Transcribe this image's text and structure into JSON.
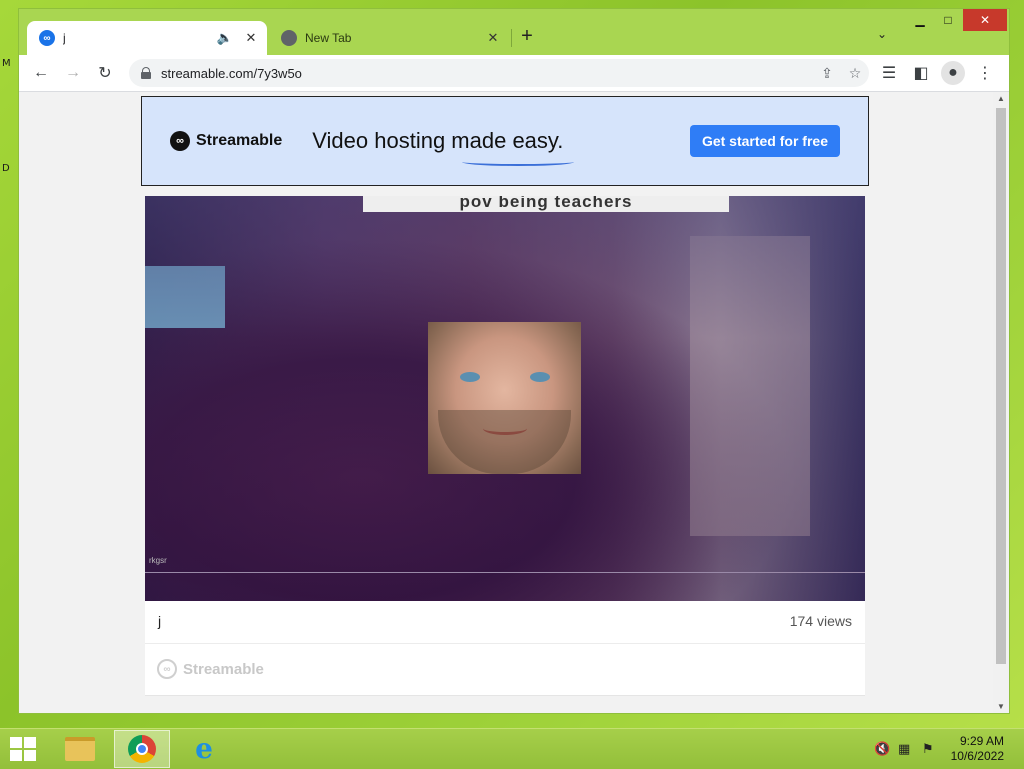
{
  "desktop": {
    "edge_letters": [
      "M",
      "D"
    ]
  },
  "browser": {
    "tabs": [
      {
        "title": "j",
        "active": true,
        "audio_icon": "speaker-icon",
        "close": "✕"
      },
      {
        "title": "New Tab",
        "active": false,
        "close": "✕"
      }
    ],
    "new_tab": "+",
    "tab_search": "⌄",
    "window_controls": {
      "minimize": "▁",
      "maximize": "□",
      "close": "✕"
    },
    "nav": {
      "back": "←",
      "forward": "→",
      "reload": "↻"
    },
    "address": {
      "url": "streamable.com/7y3w5o"
    },
    "toolbar_icons": [
      "share-icon",
      "bookmark-star-icon",
      "reading-list-icon",
      "side-panel-icon",
      "profile-icon",
      "menu-icon"
    ]
  },
  "page": {
    "banner": {
      "brand": "Streamable",
      "tagline": "Video hosting made easy.",
      "cta": "Get started for free"
    },
    "video": {
      "caption": "pov being teachers",
      "watermark": "rkgsr"
    },
    "info": {
      "title": "j",
      "views": "174 views",
      "brand": "Streamable"
    }
  },
  "taskbar": {
    "apps": [
      "file-explorer",
      "google-chrome",
      "internet-explorer"
    ],
    "active_app": "google-chrome",
    "clock": {
      "time": "9:29 AM",
      "date": "10/6/2022"
    }
  },
  "colors": {
    "desktop_green": "#9fd23a",
    "banner_bg": "#d6e4fb",
    "cta_blue": "#2f7df6",
    "close_red": "#c7392b"
  }
}
